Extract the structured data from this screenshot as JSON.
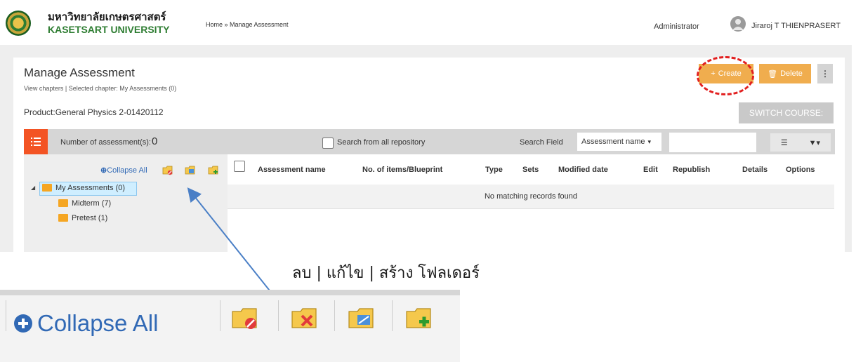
{
  "header": {
    "university_th": "มหาวิทยาลัยเกษตรศาสตร์",
    "university_en": "KASETSART UNIVERSITY",
    "breadcrumb": "Home » Manage Assessment",
    "role": "Administrator",
    "user_name": "Jiraroj  T THIENPRASERT"
  },
  "page": {
    "title": "Manage Assessment",
    "subtitle": "View chapters | Selected chapter: My Assessments (0)",
    "product_label": "Product:General Physics 2-01420112",
    "create_label": "Create",
    "delete_label": "Delete",
    "switch_course_label": "SWITCH COURSE:"
  },
  "toolbar": {
    "count_label": "Number of assessment(s):",
    "count_value": "0",
    "search_all_label": "Search from all repository",
    "search_field_label": "Search Field",
    "search_field_value": "Assessment name"
  },
  "tree": {
    "collapse_all_label": "Collapse All",
    "nodes": [
      {
        "label": "My Assessments (0)"
      },
      {
        "label": "Midterm (7)"
      },
      {
        "label": "Pretest (1)"
      }
    ]
  },
  "table": {
    "columns": [
      "Assessment name",
      "No. of items/Blueprint",
      "Type",
      "Sets",
      "Modified date",
      "Edit",
      "Republish",
      "Details",
      "Options"
    ],
    "empty_message": "No matching records found"
  },
  "annotation": {
    "text": "ลบ  | แก้ไข | สร้าง  โฟลเดอร์"
  },
  "zoom": {
    "collapse_all_label": "Collapse All"
  },
  "colors": {
    "accent_orange": "#f0ad4e",
    "toolbar_orange": "#f35424",
    "link_blue": "#3169b5",
    "highlight_red": "#e21f1f",
    "arrow_blue": "#4a7fc6"
  }
}
